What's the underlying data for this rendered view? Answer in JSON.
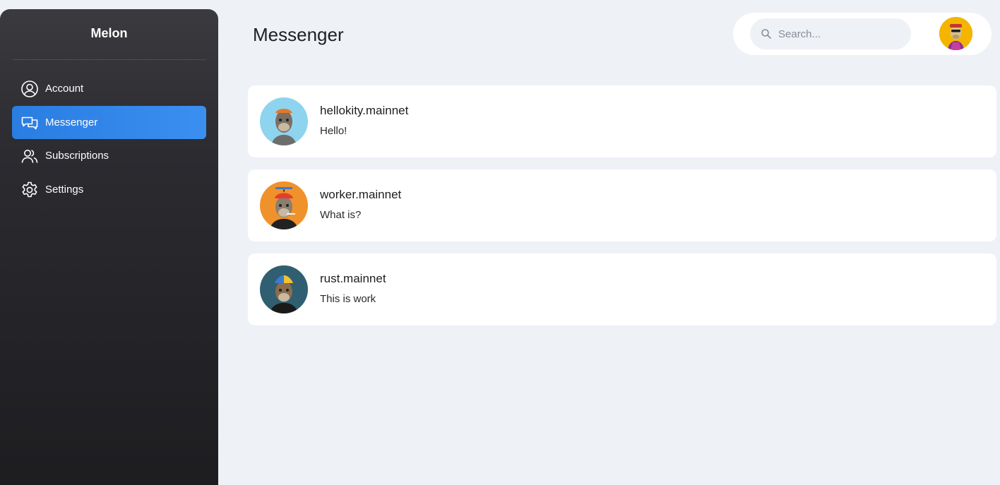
{
  "sidebar": {
    "brand": "Melon",
    "items": [
      {
        "label": "Account",
        "icon": "user-circle-icon",
        "active": false
      },
      {
        "label": "Messenger",
        "icon": "chat-bubbles-icon",
        "active": true
      },
      {
        "label": "Subscriptions",
        "icon": "users-icon",
        "active": false
      },
      {
        "label": "Settings",
        "icon": "gear-icon",
        "active": false
      }
    ]
  },
  "header": {
    "title": "Messenger",
    "search_placeholder": "Search...",
    "search_value": ""
  },
  "conversations": [
    {
      "name": "hellokity.mainnet",
      "message": "Hello!",
      "avatar_bg": "#8fd4ee"
    },
    {
      "name": "worker.mainnet",
      "message": "What is?",
      "avatar_bg": "#f0922b"
    },
    {
      "name": "rust.mainnet",
      "message": "This is work",
      "avatar_bg": "#2f5f70"
    }
  ],
  "colors": {
    "accent": "#2f86ea",
    "sidebar_bg": "#2b2b30",
    "page_bg": "#eef1f6",
    "user_avatar_bg": "#f4b400"
  }
}
